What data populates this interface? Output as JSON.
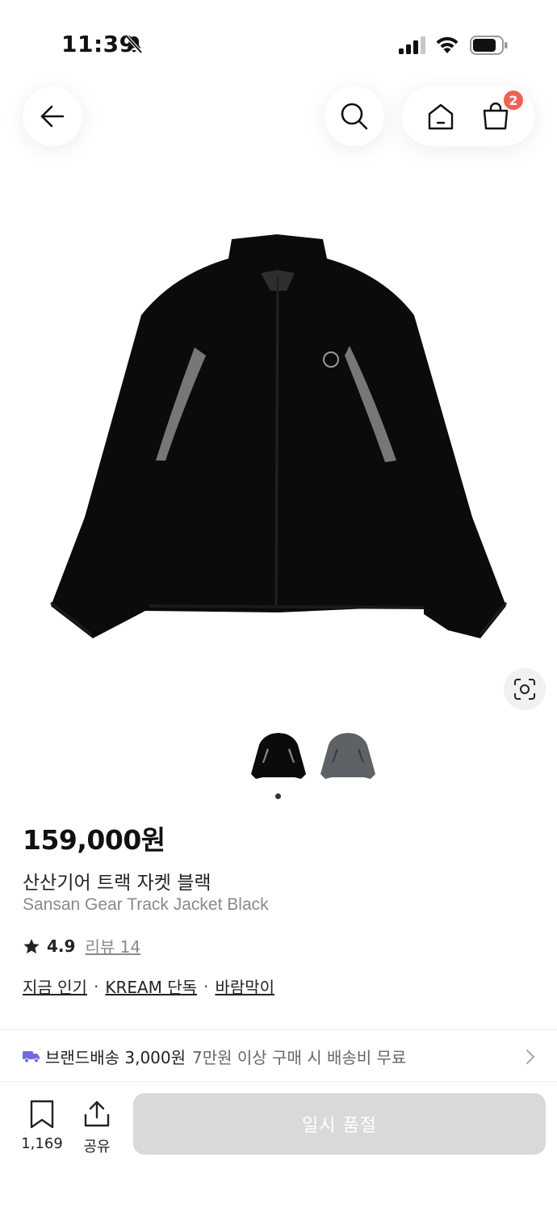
{
  "status": {
    "time": "11:39"
  },
  "nav": {
    "cart_count": "2"
  },
  "product": {
    "price": "159,000원",
    "name_ko": "산산기어 트랙 자켓 블랙",
    "name_en": "Sansan Gear Track Jacket Black",
    "rating": "4.9",
    "review_label": "리뷰 14",
    "tags": [
      "지금 인기",
      "KREAM 단독",
      "바람막이"
    ],
    "tag_separator": "·"
  },
  "shipping": {
    "main": "브랜드배송 3,000원",
    "sub": "7만원 이상 구매 시 배송비 무료"
  },
  "bottom": {
    "save_count": "1,169",
    "share_label": "공유",
    "soldout_label": "일시 품절"
  },
  "colors": {
    "badge": "#ef6253",
    "truck": "#6f6ae0",
    "soldout": "#d9d9d9"
  }
}
